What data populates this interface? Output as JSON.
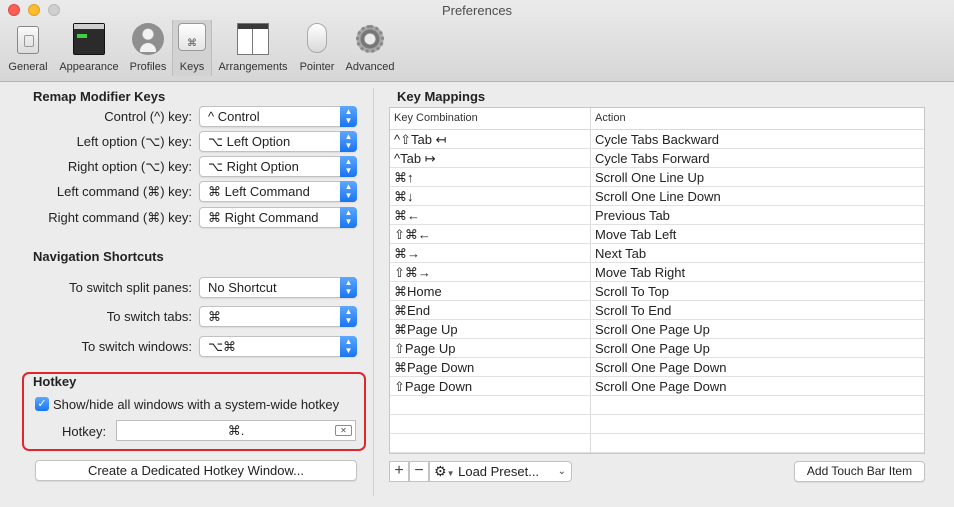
{
  "window": {
    "title": "Preferences"
  },
  "toolbar": {
    "tabs": [
      {
        "label": "General",
        "icon": "general-icon"
      },
      {
        "label": "Appearance",
        "icon": "appearance-icon"
      },
      {
        "label": "Profiles",
        "icon": "profiles-icon"
      },
      {
        "label": "Keys",
        "icon": "keys-icon",
        "selected": true,
        "glyph": "⌘"
      },
      {
        "label": "Arrangements",
        "icon": "arrangements-icon"
      },
      {
        "label": "Pointer",
        "icon": "pointer-icon"
      },
      {
        "label": "Advanced",
        "icon": "advanced-icon"
      }
    ]
  },
  "remap": {
    "title": "Remap Modifier Keys",
    "rows": [
      {
        "label": "Control (^) key:",
        "value": "^ Control"
      },
      {
        "label": "Left option (⌥) key:",
        "value": "⌥ Left Option"
      },
      {
        "label": "Right option (⌥) key:",
        "value": "⌥ Right Option"
      },
      {
        "label": "Left command (⌘) key:",
        "value": "⌘ Left Command"
      },
      {
        "label": "Right command (⌘) key:",
        "value": "⌘ Right Command"
      }
    ]
  },
  "nav": {
    "title": "Navigation Shortcuts",
    "rows": [
      {
        "label": "To switch split panes:",
        "value": "No Shortcut"
      },
      {
        "label": "To switch tabs:",
        "value": "⌘"
      },
      {
        "label": "To switch windows:",
        "value": "⌥⌘"
      }
    ]
  },
  "hotkey": {
    "title": "Hotkey",
    "checkbox_label": "Show/hide all windows with a system-wide hotkey",
    "checked": true,
    "field_label": "Hotkey:",
    "field_value": "⌘.",
    "dedicated_button": "Create a Dedicated Hotkey Window..."
  },
  "key_mappings": {
    "title": "Key Mappings",
    "columns": [
      "Key Combination",
      "Action"
    ],
    "rows": [
      {
        "combo": "^⇧Tab ↤",
        "action": "Cycle Tabs Backward"
      },
      {
        "combo": "^Tab ↦",
        "action": "Cycle Tabs Forward"
      },
      {
        "combo": "⌘↑",
        "action": "Scroll One Line Up"
      },
      {
        "combo": "⌘↓",
        "action": "Scroll One Line Down"
      },
      {
        "combo": "⌘←",
        "action": "Previous Tab"
      },
      {
        "combo": "⇧⌘←",
        "action": "Move Tab Left"
      },
      {
        "combo": "⌘→",
        "action": "Next Tab"
      },
      {
        "combo": "⇧⌘→",
        "action": "Move Tab Right"
      },
      {
        "combo": "⌘Home",
        "action": "Scroll To Top"
      },
      {
        "combo": "⌘End",
        "action": "Scroll To End"
      },
      {
        "combo": "⌘Page Up",
        "action": "Scroll One Page Up"
      },
      {
        "combo": "⇧Page Up",
        "action": "Scroll One Page Up"
      },
      {
        "combo": "⌘Page Down",
        "action": "Scroll One Page Down"
      },
      {
        "combo": "⇧Page Down",
        "action": "Scroll One Page Down"
      }
    ],
    "add_label": "+",
    "remove_label": "−",
    "preset_icon": "gear-icon",
    "preset_label": "Load Preset...",
    "touch_bar_button": "Add Touch Bar Item"
  },
  "colors": {
    "accent": "#1a76f2",
    "highlight_border": "#e0262d"
  }
}
